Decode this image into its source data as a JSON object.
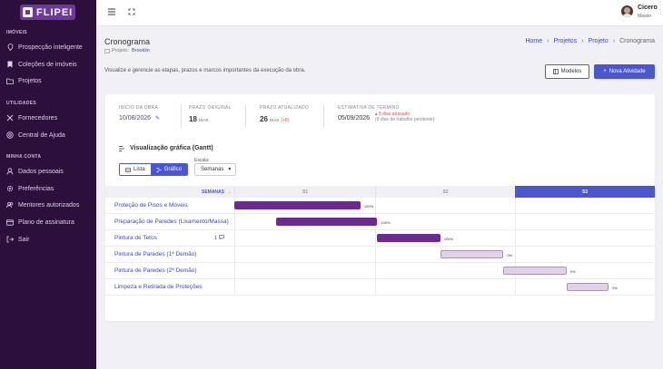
{
  "app": {
    "logo_text": "FLIPEI"
  },
  "sidebar": {
    "sections": [
      {
        "title": "IMÓVEIS",
        "items": [
          {
            "label": "Prospecção inteligente",
            "icon": "location-pin-icon"
          },
          {
            "label": "Coleções de imóveis",
            "icon": "bookmark-icon"
          },
          {
            "label": "Projetos",
            "icon": "folder-icon"
          }
        ]
      },
      {
        "title": "UTILIDADES",
        "items": [
          {
            "label": "Fornecedores",
            "icon": "tools-icon"
          },
          {
            "label": "Central de Ajuda",
            "icon": "help-icon"
          }
        ]
      },
      {
        "title": "MINHA CONTA",
        "items": [
          {
            "label": "Dados pessoais",
            "icon": "user-icon"
          },
          {
            "label": "Preferências",
            "icon": "gear-icon"
          },
          {
            "label": "Mentores autorizados",
            "icon": "users-icon"
          },
          {
            "label": "Plano de assinatura",
            "icon": "card-icon"
          },
          {
            "label": "Sair",
            "icon": "logout-icon"
          }
        ]
      }
    ]
  },
  "topbar": {
    "menu_icon": "hamburger-icon",
    "fullscreen_icon": "expand-icon"
  },
  "user": {
    "name": "Cicero",
    "role": "Master"
  },
  "page": {
    "title": "Cronograma",
    "project_prefix": "Projeto:",
    "project_name": "Brooklin",
    "description": "Visualize e gerencie as etapas, prazos e marcos importantes da execução da obra.",
    "breadcrumbs": [
      "Home",
      "Projetos",
      "Projeto",
      "Cronograma"
    ]
  },
  "buttons": {
    "models": "Modelos",
    "new_activity": "Nova Atividade"
  },
  "stats": {
    "start_label": "INÍCIO DA OBRA",
    "start_value": "10/08/2026",
    "orig_label": "PRAZO ORIGINAL",
    "orig_value": "18",
    "orig_unit": "DIAS",
    "upd_label": "PRAZO ATUALIZADO",
    "upd_value": "26",
    "upd_unit": "DIAS",
    "upd_delta": "(+8)",
    "est_label": "ESTIMATIVA DE TÉRMINO",
    "est_value": "05/09/2026",
    "delay": "8 dias atrasado",
    "delay_sub": "(8 dias de trabalho pendente)"
  },
  "gantt": {
    "title": "Visualização gráfica (Gantt)",
    "view_list": "Lista",
    "view_chart": "Gráfico",
    "scale_label": "Escala:",
    "scale_value": "Semanas",
    "weeks_header": "SEMANAS",
    "weeks": [
      "S1",
      "S2",
      "S3"
    ],
    "tasks": [
      {
        "name": "Proteção de Pisos e Móveis",
        "progress": "100%",
        "start": 0.0,
        "end": 0.3,
        "done": true
      },
      {
        "name": "Preparação de Paredes (Lixamento/Massa)",
        "progress": "100%",
        "start": 0.1,
        "end": 0.34,
        "done": true
      },
      {
        "name": "Pintura de Tetos",
        "progress": "100%",
        "start": 0.34,
        "end": 0.49,
        "done": true,
        "comments": "1"
      },
      {
        "name": "Pintura de Paredes (1ª Demão)",
        "progress": "0%",
        "start": 0.49,
        "end": 0.64,
        "done": false
      },
      {
        "name": "Pintura de Paredes (2ª Demão)",
        "progress": "0%",
        "start": 0.64,
        "end": 0.79,
        "done": false
      },
      {
        "name": "Limpeza e Retirada de Proteções",
        "progress": "0%",
        "start": 0.79,
        "end": 0.89,
        "done": false
      }
    ]
  },
  "colors": {
    "done_bar": "#6b2b8e",
    "pending_bar": "#e0d3e6",
    "accent": "#4a55d0",
    "sidebar": "#2d0f3c"
  }
}
